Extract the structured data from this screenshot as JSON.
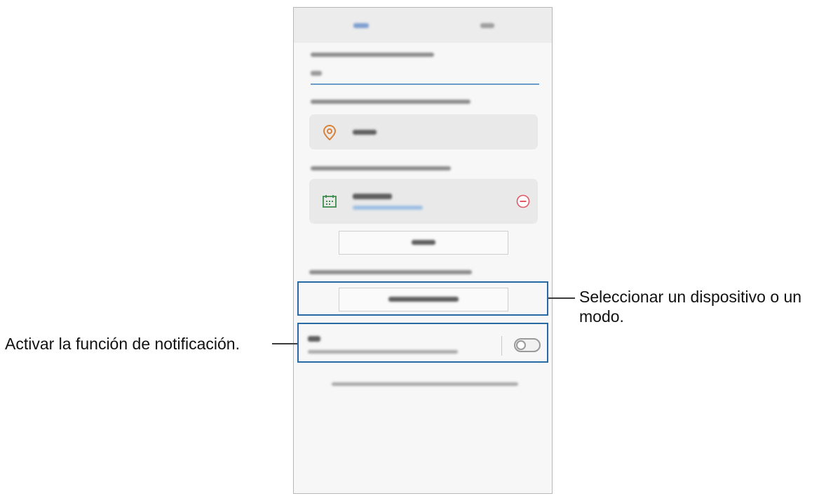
{
  "annotations": {
    "left_label": "Activar la función de notificación.",
    "right_label_line1": "Seleccionar un dispositivo o un",
    "right_label_line2": "modo."
  },
  "colors": {
    "annotation_box": "#2a6aa4",
    "location_icon": "#d9823a",
    "calendar_icon": "#3f8c4f",
    "remove_icon": "#e05a66",
    "accent_text": "#5b8fc8"
  },
  "icons": {
    "location": "location-pin-icon",
    "calendar": "calendar-icon",
    "remove": "remove-circle-icon"
  }
}
